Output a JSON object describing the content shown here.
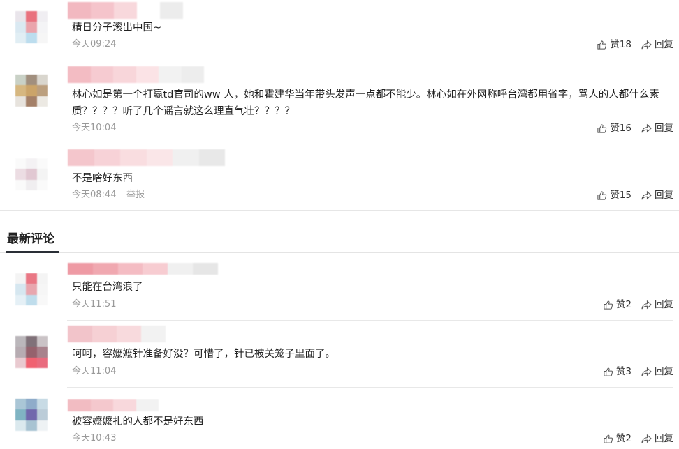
{
  "hot_comments": [
    {
      "text": "精日分子滚出中国~",
      "time": "今天09:24",
      "likes": "赞18",
      "reply": "回复",
      "report": ""
    },
    {
      "text": "林心如是第一个打赢td官司的ww 人，她和霍建华当年带头发声一点都不能少。林心如在外网称呼台湾都用省字，骂人的人都什么素质？？？？听了几个谣言就这么理直气壮？？？？",
      "time": "今天10:04",
      "likes": "赞16",
      "reply": "回复",
      "report": ""
    },
    {
      "text": "不是啥好东西",
      "time": "今天08:44",
      "likes": "赞15",
      "reply": "回复",
      "report": "举报"
    }
  ],
  "section": {
    "title": "最新评论"
  },
  "latest_comments": [
    {
      "text": "只能在台湾浪了",
      "time": "今天11:51",
      "likes": "赞2",
      "reply": "回复"
    },
    {
      "text": "呵呵，容嬷嬷针准备好没？可惜了，针已被关笼子里面了。",
      "time": "今天11:04",
      "likes": "赞3",
      "reply": "回复"
    },
    {
      "text": "被容嬷嬷扎的人都不是好东西",
      "time": "今天10:43",
      "likes": "赞2",
      "reply": "回复"
    }
  ],
  "icons": {
    "like": "thumbs-up-icon",
    "reply": "share-arrow-icon"
  },
  "colors": {
    "time": "#999999",
    "section_underline": "#2a2f36",
    "divider": "#e8e8e8"
  }
}
